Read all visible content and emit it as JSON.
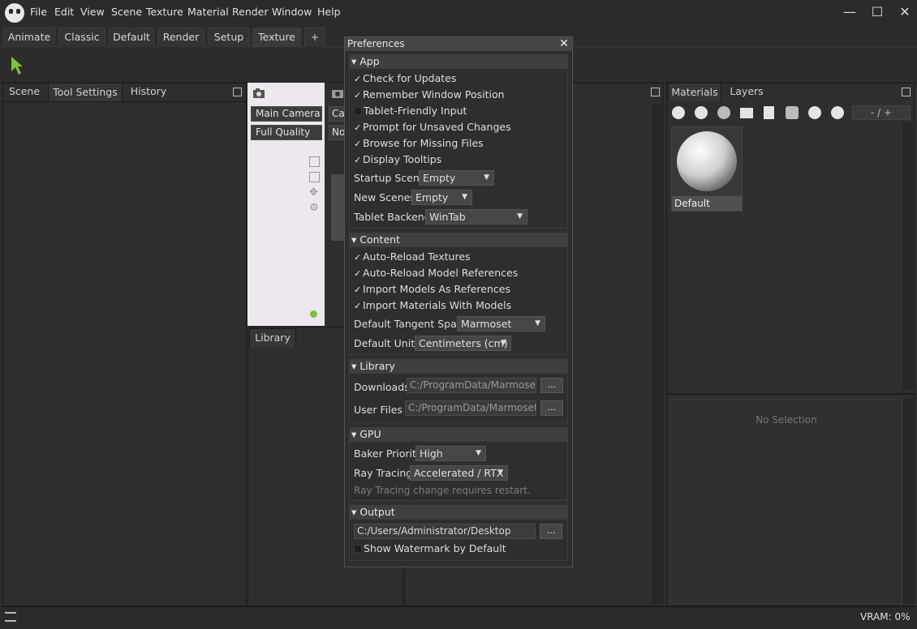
{
  "menubar": {
    "items": [
      "File",
      "Edit",
      "View",
      "Scene",
      "Texture",
      "Material",
      "Render",
      "Window",
      "Help"
    ]
  },
  "window_controls": {
    "minimize": "—",
    "maximize": "☐",
    "close": "✕"
  },
  "workspace_tabs": [
    "Animate",
    "Classic",
    "Default",
    "Render",
    "Setup",
    "Texture",
    "+"
  ],
  "workspace_active": "Texture",
  "left_panel": {
    "tabs": [
      "Scene",
      "Tool Settings",
      "History"
    ],
    "active": "Tool Settings"
  },
  "viewport": {
    "camera": "Main Camera",
    "quality": "Full Quality",
    "camera2": "Ca",
    "quality2": "No"
  },
  "library_tab": "Library",
  "prefs": {
    "title": "Preferences",
    "close": "✕",
    "app": {
      "header": "App",
      "checks": [
        {
          "label": "Check for Updates",
          "checked": true
        },
        {
          "label": "Remember Window Position",
          "checked": true
        },
        {
          "label": "Tablet-Friendly Input",
          "checked": false
        },
        {
          "label": "Prompt for Unsaved Changes",
          "checked": true
        },
        {
          "label": "Browse for Missing Files",
          "checked": true
        },
        {
          "label": "Display Tooltips",
          "checked": true
        }
      ],
      "startup_label": "Startup Scene",
      "startup_value": "Empty",
      "new_label": "New Scenes",
      "new_value": "Empty",
      "tablet_label": "Tablet Backend",
      "tablet_value": "WinTab"
    },
    "content": {
      "header": "Content",
      "checks": [
        {
          "label": "Auto-Reload Textures",
          "checked": true
        },
        {
          "label": "Auto-Reload Model References",
          "checked": true
        },
        {
          "label": "Import Models As References",
          "checked": true
        },
        {
          "label": "Import Materials With Models",
          "checked": true
        }
      ],
      "tangent_label": "Default Tangent Space",
      "tangent_value": "Marmoset",
      "units_label": "Default Units",
      "units_value": "Centimeters (cm)"
    },
    "library": {
      "header": "Library",
      "downloads_label": "Downloads",
      "downloads_value": "C:/ProgramData/Marmoset T",
      "user_label": "User Files",
      "user_value": "C:/ProgramData/Marmoset To",
      "browse": "..."
    },
    "gpu": {
      "header": "GPU",
      "baker_label": "Baker Priority",
      "baker_value": "High",
      "ray_label": "Ray Tracing",
      "ray_value": "Accelerated / RTX",
      "note": "Ray Tracing change requires restart."
    },
    "output": {
      "header": "Output",
      "path": "C:/Users/Administrator/Desktop",
      "browse": "...",
      "watermark": "Show Watermark by Default",
      "watermark_checked": false
    }
  },
  "right_panel": {
    "tabs": [
      "Materials",
      "Layers"
    ],
    "active": "Materials",
    "counter": "- / +",
    "material_name": "Default",
    "no_selection": "No Selection"
  },
  "status": {
    "vram": "VRAM: 0%"
  },
  "colors": {
    "accent_green": "#7dc23a",
    "bg": "#2e2e2e"
  }
}
